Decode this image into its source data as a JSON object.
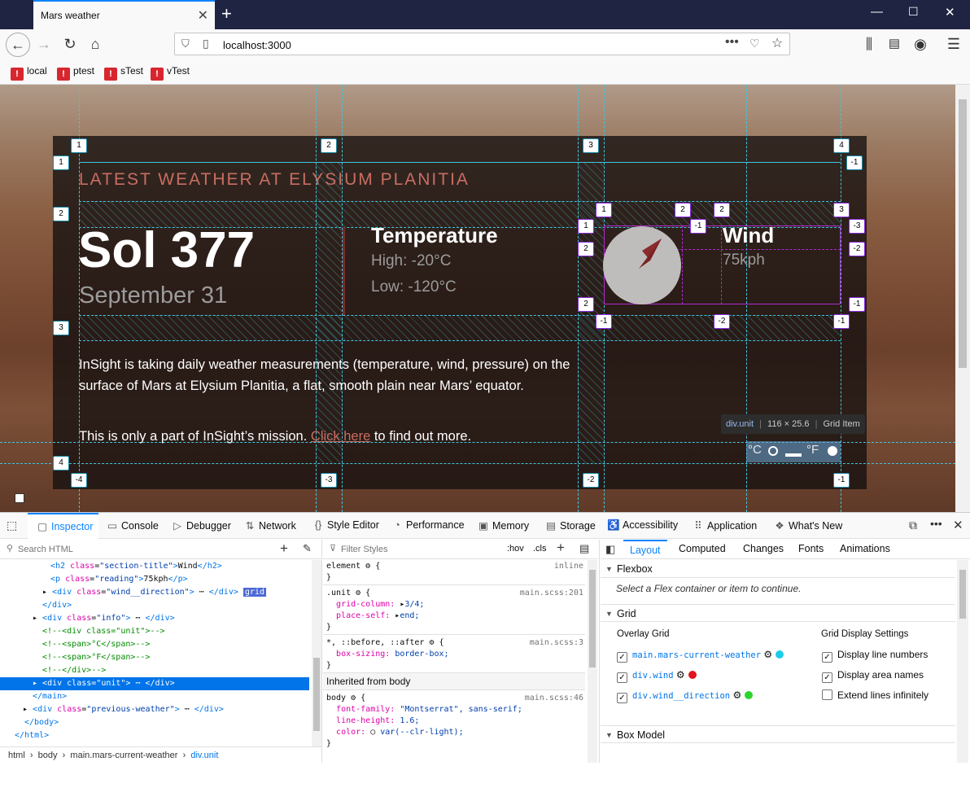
{
  "browser": {
    "tab_title": "Mars weather",
    "url": "localhost:3000",
    "bookmarks": [
      "local",
      "ptest",
      "sTest",
      "vTest"
    ]
  },
  "page": {
    "section_title": "LATEST WEATHER AT ELYSIUM PLANITIA",
    "sol": "Sol 377",
    "date": "September 31",
    "temperature": {
      "title": "Temperature",
      "high": "High: -20°C",
      "low": "Low: -120°C"
    },
    "wind": {
      "title": "Wind",
      "reading": "75kph"
    },
    "info_1": "InSight is taking daily weather measurements (temperature, wind, pressure) on the surface of Mars at Elysium Planitia, a flat, smooth plain near Mars’ equator.",
    "info_2_prefix": "This is only a part of InSight’s mission. ",
    "info_2_link": "Click here",
    "info_2_suffix": " to find out more.",
    "unit_c": "°C",
    "unit_f": "°F"
  },
  "tooltip": {
    "selector": "div.unit",
    "size": "116 × 25.6",
    "kind": "Grid Item"
  },
  "devtools": {
    "tabs": [
      "Inspector",
      "Console",
      "Debugger",
      "Network",
      "Style Editor",
      "Performance",
      "Memory",
      "Storage",
      "Accessibility",
      "Application",
      "What's New"
    ],
    "search_placeholder": "Search HTML",
    "filter_placeholder": "Filter Styles",
    "hov": ":hov",
    "cls": ".cls",
    "html_tree": [
      "<h2 class=\"section-title\">Wind</h2>",
      "<p class=\"reading\">75kph</p>",
      "<div class=\"wind__direction\"> </div> grid",
      "</div>",
      "<div class=\"info\"> </div>",
      "<!--<div class=\"unit\">-->",
      "<!--<span>°C</span>-->",
      "<!--<span>°F</span>-->",
      "<!--</div>-->",
      "<div class=\"unit\"> </div>",
      "</main>",
      "<div class=\"previous-weather\"> </div>",
      "</body>",
      "</html>"
    ],
    "breadcrumbs": [
      "html",
      "body",
      "main.mars-current-weather",
      "div.unit"
    ],
    "rules": {
      "element_sel": "element",
      "element_src": "inline",
      "unit_sel": ".unit",
      "unit_src": "main.scss:201",
      "unit_p1": "grid-column:",
      "unit_v1": "3/4;",
      "unit_p2": "place-self:",
      "unit_v2": "end;",
      "star_sel": "*, ::before, ::after",
      "star_src": "main.scss:3",
      "star_p1": "box-sizing:",
      "star_v1": "border-box;",
      "inherited": "Inherited from body",
      "body_sel": "body",
      "body_src": "main.scss:46",
      "body_p1": "font-family:",
      "body_v1": "\"Montserrat\", sans-serif;",
      "body_p2": "line-height:",
      "body_v2": "1.6;",
      "body_p3": "color:",
      "body_v3": "var(--clr-light);"
    },
    "layout_tabs": [
      "Layout",
      "Computed",
      "Changes",
      "Fonts",
      "Animations"
    ],
    "flexbox_title": "Flexbox",
    "flexbox_msg": "Select a Flex container or item to continue.",
    "grid_title": "Grid",
    "overlay_grid": "Overlay Grid",
    "display_settings": "Grid Display Settings",
    "overlays": [
      {
        "name": "main.mars-current-weather",
        "color": "#1ecbe9"
      },
      {
        "name": "div.wind",
        "color": "#e1151a"
      },
      {
        "name": "div.wind__direction",
        "color": "#2ed42e"
      }
    ],
    "settings": [
      "Display line numbers",
      "Display area names",
      "Extend lines infinitely"
    ],
    "box_model": "Box Model"
  }
}
